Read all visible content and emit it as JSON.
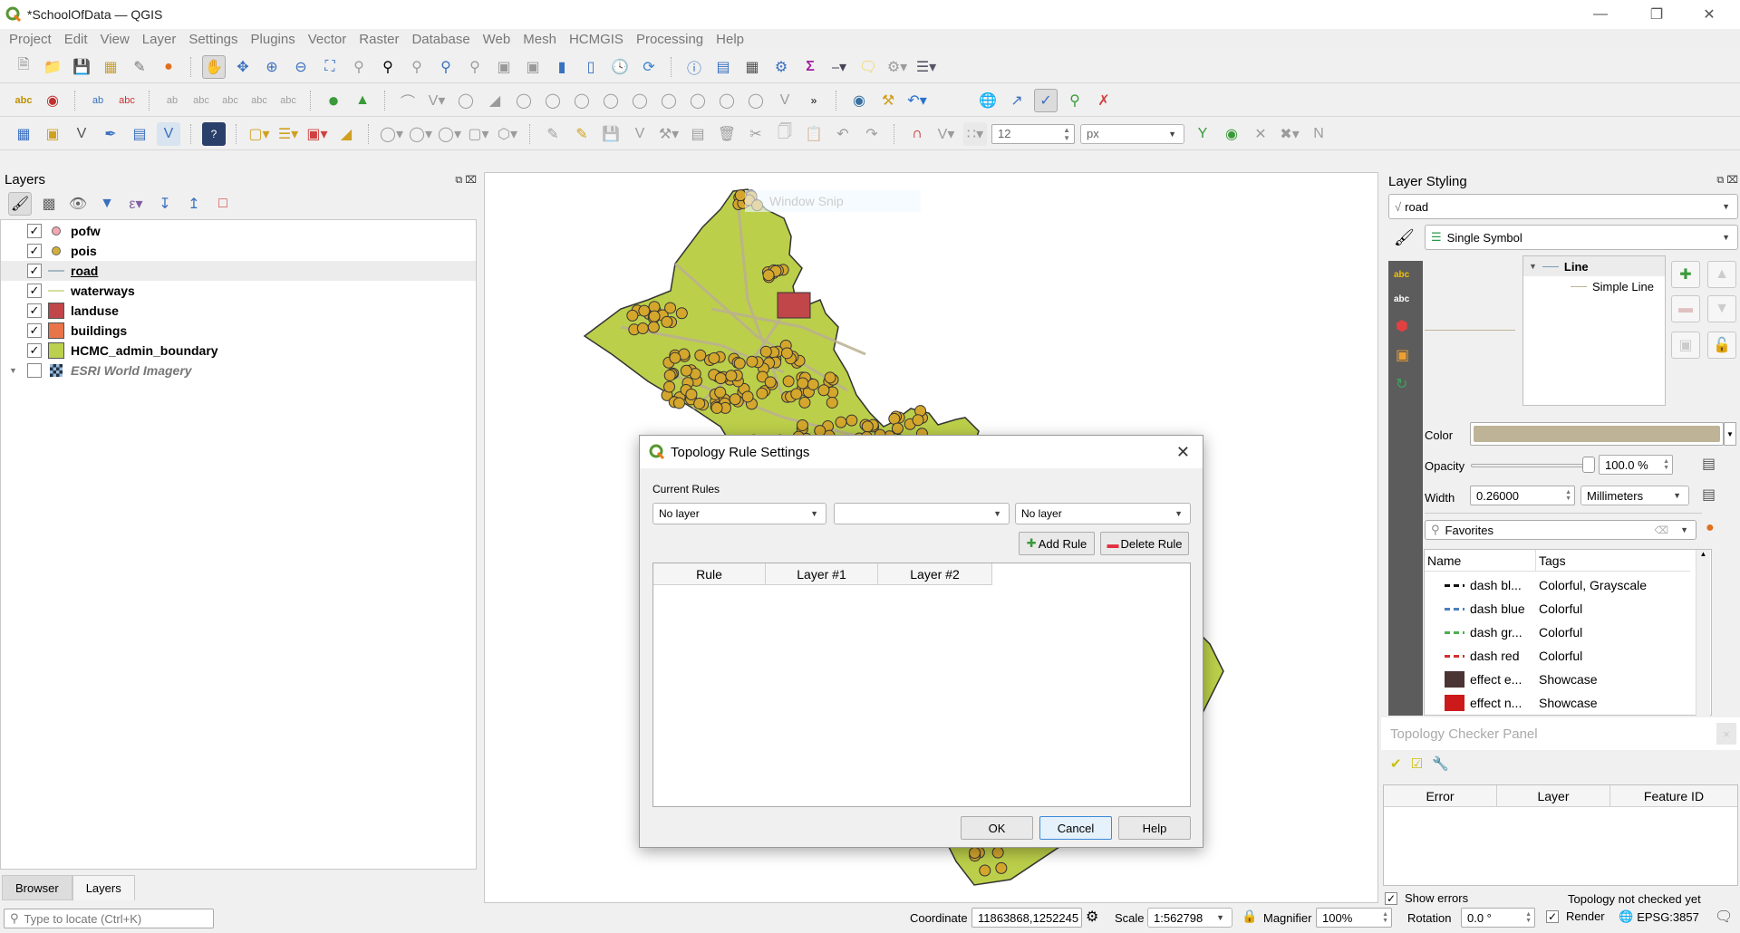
{
  "window": {
    "title": "*SchoolOfData — QGIS",
    "minimize_icon": "minimize-icon",
    "maximize_icon": "restore-icon",
    "close_icon": "close-icon"
  },
  "menu": [
    "Project",
    "Edit",
    "View",
    "Layer",
    "Settings",
    "Plugins",
    "Vector",
    "Raster",
    "Database",
    "Web",
    "Mesh",
    "HCMGIS",
    "Processing",
    "Help"
  ],
  "snapping": {
    "tolerance": "12",
    "unit": "px"
  },
  "layers_panel": {
    "title": "Layers",
    "layers": [
      {
        "name": "pofw",
        "checked": true,
        "symbol": "point",
        "color": "#f4a7b0"
      },
      {
        "name": "pois",
        "checked": true,
        "symbol": "point",
        "color": "#d4af37"
      },
      {
        "name": "road",
        "checked": true,
        "symbol": "line",
        "color": "#a8b8c4",
        "selected": true
      },
      {
        "name": "waterways",
        "checked": true,
        "symbol": "line",
        "color": "#d2dfa0"
      },
      {
        "name": "landuse",
        "checked": true,
        "symbol": "fill",
        "color": "#c0464a"
      },
      {
        "name": "buildings",
        "checked": true,
        "symbol": "fill",
        "color": "#e8744a"
      },
      {
        "name": "HCMC_admin_boundary",
        "checked": true,
        "symbol": "fill",
        "color": "#bcd050"
      },
      {
        "name": "ESRI World Imagery",
        "checked": false,
        "symbol": "raster",
        "color": "#444"
      }
    ],
    "tabs": [
      "Browser",
      "Layers"
    ],
    "active_tab": "Layers",
    "locator_placeholder": "Type to locate (Ctrl+K)"
  },
  "map": {
    "overlay_text": "Window Snip",
    "boundary_color": "#bccf4a",
    "road_color": "#bbb092",
    "poi_color": "#d4a72c"
  },
  "layer_styling": {
    "title": "Layer Styling",
    "layer": "road",
    "renderer": "Single Symbol",
    "symbol_tree": {
      "root": "Line",
      "child": "Simple Line"
    },
    "color_label": "Color",
    "color_value": "#bfb397",
    "opacity_label": "Opacity",
    "opacity_value": "100.0 %",
    "width_label": "Width",
    "width_value": "0.26000",
    "width_unit": "Millimeters",
    "search_value": "Favorites",
    "symbol_list": {
      "headers": [
        "Name",
        "Tags"
      ],
      "rows": [
        {
          "name": "dash  bl...",
          "tags": "Colorful, Grayscale",
          "color": "#111111",
          "type": "dash"
        },
        {
          "name": "dash blue",
          "tags": "Colorful",
          "color": "#4a7fc0",
          "type": "dash"
        },
        {
          "name": "dash gr...",
          "tags": "Colorful",
          "color": "#4caf50",
          "type": "dash"
        },
        {
          "name": "dash red",
          "tags": "Colorful",
          "color": "#d32f2f",
          "type": "dash"
        },
        {
          "name": "effect e...",
          "tags": "Showcase",
          "color": "#4a3434",
          "type": "fill"
        },
        {
          "name": "effect n...",
          "tags": "Showcase",
          "color": "#cc1a1a",
          "type": "fill"
        }
      ]
    }
  },
  "topology_panel": {
    "title": "Topology Checker Panel",
    "columns": [
      "Error",
      "Layer",
      "Feature ID"
    ],
    "show_errors_label": "Show errors",
    "show_errors_checked": true,
    "status": "Topology not checked yet"
  },
  "statusbar": {
    "coordinate_label": "Coordinate",
    "coordinate_value": "11863868,1252245",
    "scale_label": "Scale",
    "scale_value": "1:562798",
    "magnifier_label": "Magnifier",
    "magnifier_value": "100%",
    "rotation_label": "Rotation",
    "rotation_value": "0.0 °",
    "render_label": "Render",
    "render_checked": true,
    "crs": "EPSG:3857"
  },
  "dialog": {
    "title": "Topology Rule Settings",
    "current_rules_label": "Current Rules",
    "layer1_value": "No layer",
    "rule_value": "",
    "layer2_value": "No layer",
    "add_rule": "Add Rule",
    "delete_rule": "Delete Rule",
    "columns": [
      "Rule",
      "Layer #1",
      "Layer #2"
    ],
    "ok": "OK",
    "cancel": "Cancel",
    "help": "Help"
  }
}
